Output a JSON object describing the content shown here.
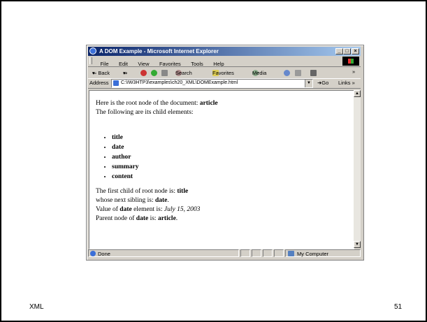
{
  "slide": {
    "footer_left": "XML",
    "footer_right": "51"
  },
  "window": {
    "title": "A DOM Example - Microsoft Internet Explorer",
    "controls": {
      "minimize": "_",
      "maximize": "□",
      "close": "×"
    }
  },
  "menu": [
    "File",
    "Edit",
    "View",
    "Favorites",
    "Tools",
    "Help"
  ],
  "toolbar": {
    "back": "⇐ Back",
    "back_arrow": "▾",
    "forward": "⇒",
    "forward_arrow": "▾",
    "search": "Search",
    "favorites": "Favorites",
    "media": "Media",
    "more": "»"
  },
  "address": {
    "label": "Address",
    "url": "C:\\IW3HTP3\\examples\\ch20_XML\\DOMExample.html",
    "go": "Go",
    "links": "Links »"
  },
  "document": {
    "line1_prefix": "Here is the root node of the document: ",
    "line1_value": "article",
    "line2": "The following are its child elements:",
    "children": [
      "title",
      "date",
      "author",
      "summary",
      "content"
    ],
    "first_child_prefix": "The first child of root node is: ",
    "first_child_value": "title",
    "sibling_prefix": "whose next sibling is: ",
    "sibling_value": "date",
    "sibling_suffix": ".",
    "value_prefix": "Value of ",
    "value_element": "date",
    "value_mid": " element is: ",
    "value_value": "July 15, 2003",
    "parent_prefix": "Parent node of ",
    "parent_element": "date",
    "parent_mid": " is: ",
    "parent_value": "article",
    "parent_suffix": "."
  },
  "status": {
    "text": "Done",
    "zone": "My Computer"
  },
  "icons": [
    "ie-logo-icon",
    "windows-logo-icon",
    "search-icon",
    "favorites-icon",
    "media-icon",
    "history-icon",
    "mail-icon",
    "print-icon",
    "page-icon",
    "computer-icon"
  ]
}
